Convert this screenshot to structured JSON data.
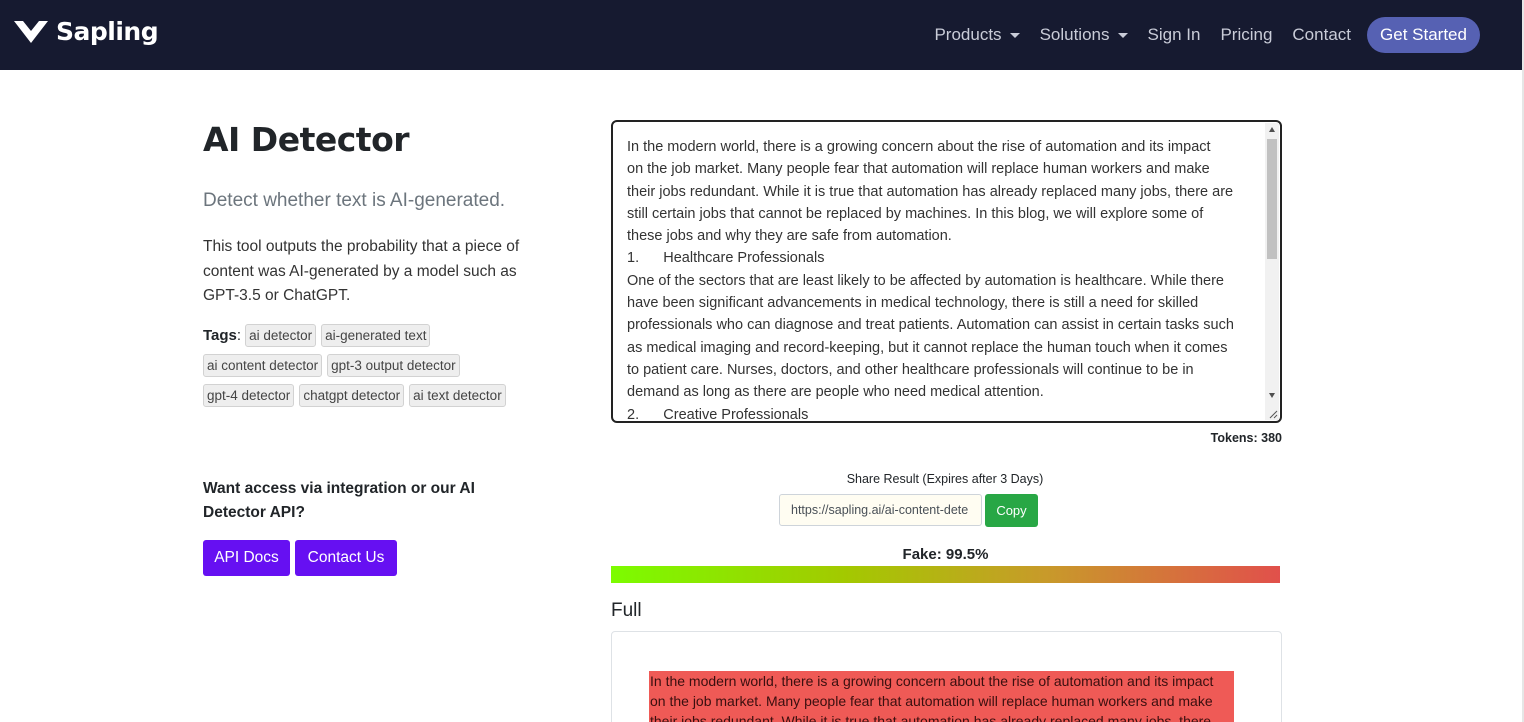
{
  "brand": {
    "name": "Sapling",
    "logo_icon": "sapling-v-logo"
  },
  "nav": {
    "products": "Products",
    "solutions": "Solutions",
    "sign_in": "Sign In",
    "pricing": "Pricing",
    "contact": "Contact",
    "get_started": "Get Started"
  },
  "intro": {
    "title": "AI Detector",
    "subtitle": "Detect whether text is AI-generated.",
    "description": "This tool outputs the probability that a piece of content was AI-generated by a model such as GPT-3.5 or ChatGPT.",
    "tags_label": "Tags",
    "tags_colon": ":",
    "tags": [
      "ai detector",
      "ai-generated text",
      "ai content detector",
      "gpt-3 output detector",
      "gpt-4 detector",
      "chatgpt detector",
      "ai text detector"
    ]
  },
  "api_section": {
    "heading": "Want access via integration or our AI Detector API?",
    "api_docs": "API Docs",
    "contact_us": "Contact Us"
  },
  "input": {
    "text": "In the modern world, there is a growing concern about the rise of automation and its impact\non the job market. Many people fear that automation will replace human workers and make\ntheir jobs redundant. While it is true that automation has already replaced many jobs, there are\nstill certain jobs that cannot be replaced by machines. In this blog, we will explore some of\nthese jobs and why they are safe from automation.\n1.      Healthcare Professionals\nOne of the sectors that are least likely to be affected by automation is healthcare. While there\nhave been significant advancements in medical technology, there is still a need for skilled\nprofessionals who can diagnose and treat patients. Automation can assist in certain tasks such\nas medical imaging and record-keeping, but it cannot replace the human touch when it comes\nto patient care. Nurses, doctors, and other healthcare professionals will continue to be in\ndemand as long as there are people who need medical attention.\n2.      Creative Professionals",
    "tokens": "Tokens: 380"
  },
  "share": {
    "label": "Share Result (Expires after 3 Days)",
    "url": "https://sapling.ai/ai-content-dete",
    "copy": "Copy"
  },
  "result": {
    "fake_label": "Fake: 99.5%",
    "fake_probability": 0.995,
    "bar_colors": [
      "#7cfc00",
      "#e1504b"
    ],
    "highlight_color": "#ef5a56"
  },
  "full": {
    "label": "Full",
    "lines": [
      "In the modern world, there is a growing concern about the rise of automation and its impact",
      "on the job market. Many people fear that automation will replace human workers and make",
      "their jobs redundant. While it is true that automation has already replaced many jobs, there"
    ]
  }
}
